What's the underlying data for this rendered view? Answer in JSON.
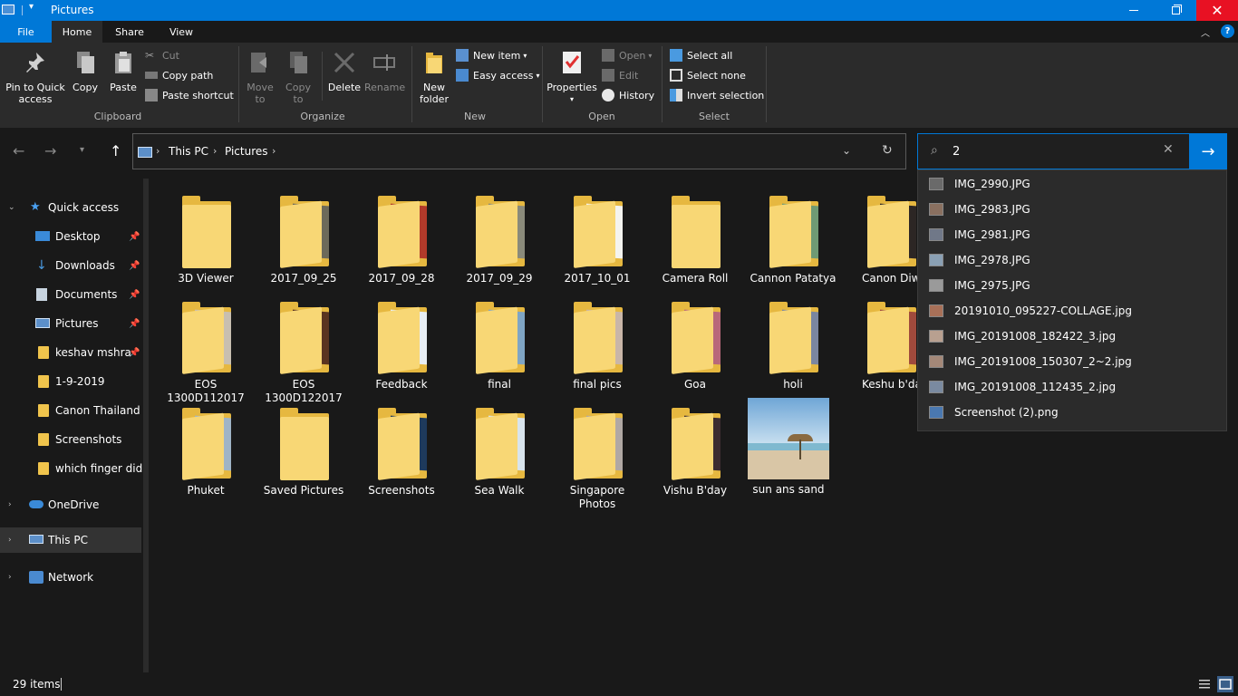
{
  "window": {
    "title": "Pictures"
  },
  "tabs": {
    "file": "File",
    "home": "Home",
    "share": "Share",
    "view": "View"
  },
  "ribbon": {
    "clipboard": {
      "label": "Clipboard",
      "pin": "Pin to Quick access",
      "copy": "Copy",
      "paste": "Paste",
      "cut": "Cut",
      "copy_path": "Copy path",
      "paste_shortcut": "Paste shortcut"
    },
    "organize": {
      "label": "Organize",
      "move_to": "Move to",
      "copy_to": "Copy to",
      "delete": "Delete",
      "rename": "Rename"
    },
    "new": {
      "label": "New",
      "new_folder": "New folder",
      "new_item": "New item",
      "easy_access": "Easy access"
    },
    "open": {
      "label": "Open",
      "properties": "Properties",
      "open": "Open",
      "edit": "Edit",
      "history": "History"
    },
    "select": {
      "label": "Select",
      "select_all": "Select all",
      "select_none": "Select none",
      "invert_selection": "Invert selection"
    }
  },
  "address": {
    "crumbs": [
      "This PC",
      "Pictures"
    ]
  },
  "search": {
    "value": "2"
  },
  "sidebar": {
    "items": [
      {
        "label": "Quick access",
        "icon": "star-icon"
      },
      {
        "label": "Desktop",
        "icon": "desktop-icon"
      },
      {
        "label": "Downloads",
        "icon": "download-icon"
      },
      {
        "label": "Documents",
        "icon": "document-icon"
      },
      {
        "label": "Pictures",
        "icon": "pictures-icon"
      },
      {
        "label": "keshav mshra",
        "icon": "folder-icon"
      },
      {
        "label": "1-9-2019",
        "icon": "folder-icon"
      },
      {
        "label": "Canon Thailand",
        "icon": "folder-icon"
      },
      {
        "label": "Screenshots",
        "icon": "folder-icon"
      },
      {
        "label": "which finger did it",
        "icon": "folder-icon"
      },
      {
        "label": "OneDrive",
        "icon": "cloud-icon"
      },
      {
        "label": "This PC",
        "icon": "computer-icon"
      },
      {
        "label": "Network",
        "icon": "network-icon"
      }
    ]
  },
  "folders": [
    {
      "label": "3D Viewer",
      "photo": null
    },
    {
      "label": "2017_09_25",
      "photo": "#6d6a5a"
    },
    {
      "label": "2017_09_28",
      "photo": "#b23a2a"
    },
    {
      "label": "2017_09_29",
      "photo": "#8a8a7a"
    },
    {
      "label": "2017_10_01",
      "photo": "#f4f4f0"
    },
    {
      "label": "Camera Roll",
      "photo": null
    },
    {
      "label": "Cannon Patatya",
      "photo": "#6f9a74"
    },
    {
      "label": "Canon Diwa",
      "photo": "#2c2624"
    },
    {
      "label": "EOS 1300D112017",
      "photo": "#c8bfb0"
    },
    {
      "label": "EOS 1300D122017",
      "photo": "#5a3420"
    },
    {
      "label": "Feedback",
      "photo": "#e8eef4"
    },
    {
      "label": "final",
      "photo": "#7fa5c4"
    },
    {
      "label": "final pics",
      "photo": "#c9b6a8"
    },
    {
      "label": "Goa",
      "photo": "#b8687a"
    },
    {
      "label": "holi",
      "photo": "#7a86a0"
    },
    {
      "label": "Keshu b'day",
      "photo": "#a04a3c"
    },
    {
      "label": "Phuket",
      "photo": "#9fb4c6"
    },
    {
      "label": "Saved Pictures",
      "photo": null
    },
    {
      "label": "Screenshots",
      "photo": "#1e3a5c"
    },
    {
      "label": "Sea Walk",
      "photo": "#d8e4ec"
    },
    {
      "label": "Singapore Photos",
      "photo": "#b0a8a4"
    },
    {
      "label": "Vishu B'day",
      "photo": "#3c2c30"
    },
    {
      "label": "sun ans sand",
      "photo": "image"
    }
  ],
  "suggestions": [
    {
      "label": "IMG_2990.JPG",
      "color": "#6a6a6a"
    },
    {
      "label": "IMG_2983.JPG",
      "color": "#8a7060"
    },
    {
      "label": "IMG_2981.JPG",
      "color": "#707888"
    },
    {
      "label": "IMG_2978.JPG",
      "color": "#8aa0b4"
    },
    {
      "label": "IMG_2975.JPG",
      "color": "#9a9a9a"
    },
    {
      "label": "20191010_095227-COLLAGE.jpg",
      "color": "#a87058"
    },
    {
      "label": "IMG_20191008_182422_3.jpg",
      "color": "#b8a090"
    },
    {
      "label": "IMG_20191008_150307_2~2.jpg",
      "color": "#a48878"
    },
    {
      "label": "IMG_20191008_112435_2.jpg",
      "color": "#7a8aa0"
    },
    {
      "label": "Screenshot (2).png",
      "color": "#4a78b0"
    }
  ],
  "status": {
    "count": "29 items"
  }
}
